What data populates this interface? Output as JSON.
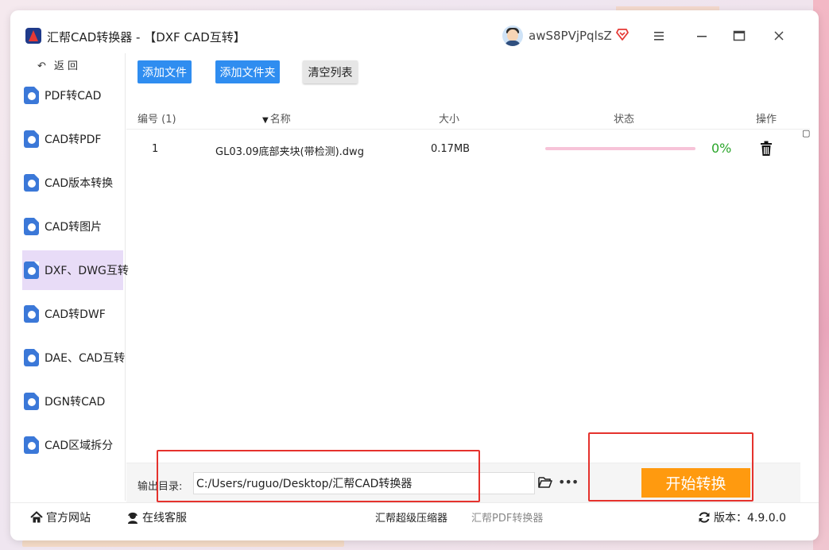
{
  "window": {
    "title": "汇帮CAD转换器 - 【DXF CAD互转】",
    "username": "awS8PVjPqlsZ"
  },
  "sidebar": {
    "back_label": "返 回",
    "items": [
      {
        "label": "PDF转CAD"
      },
      {
        "label": "CAD转PDF"
      },
      {
        "label": "CAD版本转换"
      },
      {
        "label": "CAD转图片"
      },
      {
        "label": "DXF、DWG互转",
        "active": true
      },
      {
        "label": "CAD转DWF"
      },
      {
        "label": "DAE、CAD互转"
      },
      {
        "label": "DGN转CAD"
      },
      {
        "label": "CAD区域拆分"
      }
    ]
  },
  "toolbar": {
    "add_file": "添加文件",
    "add_folder": "添加文件夹",
    "clear_list": "清空列表"
  },
  "table": {
    "headers": {
      "index": "编号 (1)",
      "name": "名称",
      "size": "大小",
      "status": "状态",
      "action": "操作"
    },
    "rows": [
      {
        "index": "1",
        "name": "GL03.09底部夹块(带检测).dwg",
        "size": "0.17MB",
        "progress": 0,
        "percent": "0%"
      }
    ]
  },
  "output": {
    "label": "输出目录:",
    "path": "C:/Users/ruguo/Desktop/汇帮CAD转换器",
    "start_label": "开始转换"
  },
  "statusbar": {
    "website": "官方网站",
    "support": "在线客服",
    "link1": "汇帮超级压缩器",
    "link2": "汇帮PDF转换器",
    "version": "版本：4.9.0.0"
  },
  "colors": {
    "primary_button": "#2f8df0",
    "start_button": "#ff9a0f",
    "progress_track": "#f7c3d8",
    "progress_text": "#2aa52a",
    "active_sidebar": "#e8dcf7",
    "annotation": "#e5322d"
  },
  "icons": {
    "app": "app-logo-icon",
    "vip": "vip-diamond-icon",
    "menu": "hamburger-menu-icon",
    "minimize": "minimize-icon",
    "maximize": "maximize-icon",
    "close": "close-icon",
    "back": "back-arrow-icon",
    "sort": "sort-desc-icon",
    "delete": "trash-icon",
    "folder": "folder-open-icon",
    "more": "more-dots-icon",
    "home": "home-icon",
    "support": "headset-icon",
    "refresh": "refresh-icon"
  }
}
